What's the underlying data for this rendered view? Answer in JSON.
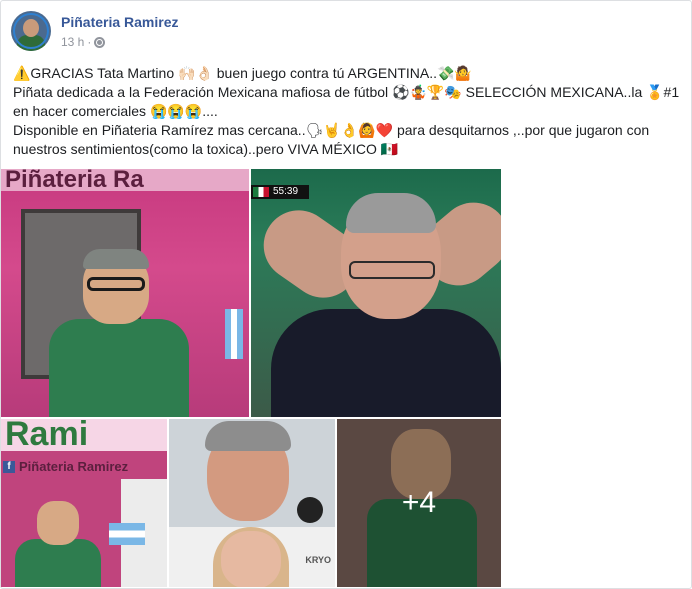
{
  "post": {
    "page_name": "Piñateria Ramirez",
    "time": "13 h",
    "separator": "·",
    "privacy_icon": "globe-icon",
    "text_lines": [
      "⚠️GRACIAS Tata Martino 🙌🏻👌🏻 buen juego contra tú ARGENTINA..💸🤷",
      "Piñata dedicada a la Federación Mexicana mafiosa de fútbol ⚽🤹🏆🎭 SELECCIÓN MEXICANA..la 🏅#1",
      "en hacer comerciales 😭😭😭....",
      "Disponible en Piñateria Ramírez mas cercana..🗣🤘👌🙆❤️ para desquitarnos ,..por que jugaron con",
      "nuestros sentimientos(como la toxica)..pero VIVA MÉXICO 🇲🇽"
    ]
  },
  "photos": {
    "photo1_sign": "Piñateria Ra",
    "photo2_score": "55:39",
    "photo3_sign": "Rami",
    "photo3_page": "Piñateria Ramirez",
    "photo3_fb": "f",
    "photo4_brand": "KRYO",
    "more_count": "+4"
  },
  "colors": {
    "link": "#385898",
    "meta": "#90949c",
    "border": "#dddfe2"
  }
}
